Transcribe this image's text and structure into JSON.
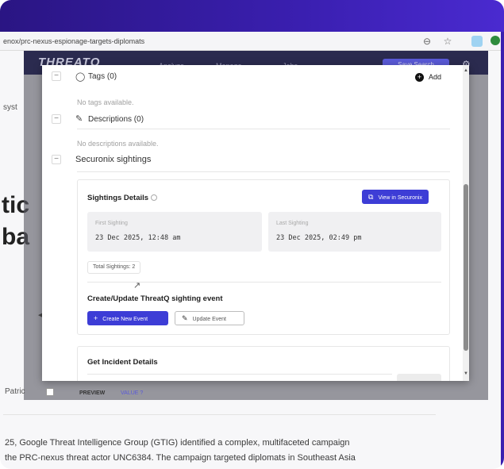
{
  "browser": {
    "url": "enox/prc-nexus-espionage-targets-diplomats",
    "icons": [
      "info-icon",
      "star-icon",
      "extension-icon",
      "profile-icon"
    ]
  },
  "app_header": {
    "logo": "THREATQ",
    "nav": [
      "Analyze",
      "Manage",
      "Jobs"
    ],
    "button": "Save Search"
  },
  "background_page": {
    "left_fragment_1": "syst",
    "big_text_1": "tic",
    "big_text_2": "ba",
    "author_fragment": "Patric",
    "row_tab_preview": "PREVIEW",
    "row_tab_value": "VALUE ?",
    "body_line_1": "25, Google Threat Intelligence Group (GTIG) identified a complex, multifaceted campaign",
    "body_line_2": " the PRC-nexus threat actor UNC6384. The campaign targeted diplomats in Southeast Asia"
  },
  "modal": {
    "tags": {
      "title": "Tags (0)",
      "add_label": "Add",
      "empty_text": "No tags available."
    },
    "descriptions": {
      "title": "Descriptions (0)",
      "empty_text": "No descriptions available."
    },
    "securonix": {
      "title": "Securonix sightings",
      "details_title": "Sightings Details",
      "view_button": "View in Securonix",
      "first_label": "First Sighting",
      "first_value": "23 Dec 2025, 12:48 am",
      "last_label": "Last Sighting",
      "last_value": "23 Dec 2025, 02:49 pm",
      "total": "Total Sightings: 2",
      "event_title": "Create/Update ThreatQ sighting event",
      "create_button": "Create New Event",
      "update_button": "Update Event"
    },
    "incident": {
      "title": "Get Incident Details"
    }
  },
  "colors": {
    "banner": "#2a1583",
    "primary_button": "#3d3dd6",
    "app_header": "#2b2b4f"
  }
}
